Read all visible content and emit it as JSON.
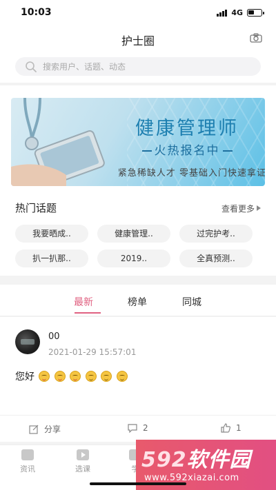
{
  "status_bar": {
    "time": "10:03",
    "network": "4G"
  },
  "header": {
    "title": "护士圈",
    "camera_icon": "camera-icon"
  },
  "search": {
    "placeholder": "搜索用户、话题、动态",
    "icon": "search-icon"
  },
  "banner": {
    "title": "健康管理师",
    "subtitle": "火热报名中",
    "tagline": "紧急稀缺人才  零基础入门快速拿证"
  },
  "hot_topics": {
    "title": "热门话题",
    "more_label": "查看更多",
    "chips": [
      "我要晒成..",
      "健康管理..",
      "过完护考..",
      "扒一扒那..",
      "2019..",
      "全真预测.."
    ]
  },
  "tabs": [
    "最新",
    "榜单",
    "同城"
  ],
  "active_tab": "最新",
  "post": {
    "username": "00",
    "time": "2021-01-29 15:57:01",
    "text": "您好",
    "share_label": "分享",
    "comment_count": "2",
    "like_count": "1"
  },
  "bottom_nav": {
    "items": [
      "资讯",
      "选课",
      "学"
    ]
  },
  "watermark": {
    "logo_digits": "592",
    "logo_text": "软件园",
    "url": "www.592xiazai.com"
  },
  "colors": {
    "accent": "#e06080",
    "banner_title": "#1d7fb0",
    "watermark": "#e85a6c"
  }
}
